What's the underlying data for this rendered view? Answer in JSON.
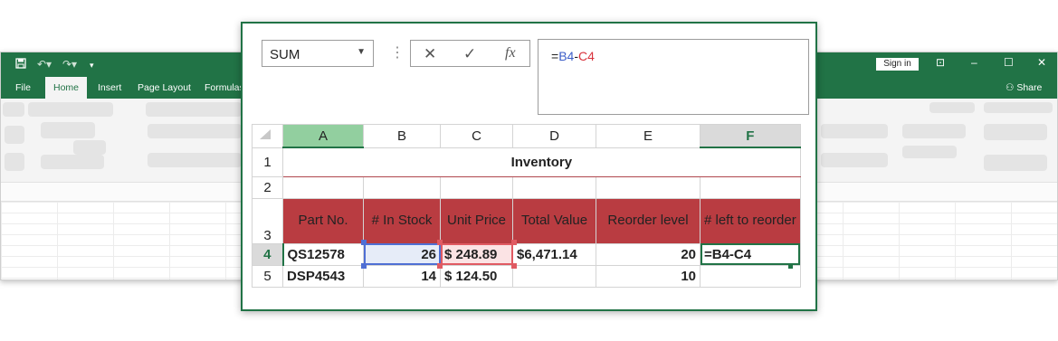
{
  "app": {
    "qat": {
      "save_icon": "save-icon",
      "undo_icon": "undo-icon",
      "redo_icon": "redo-icon",
      "customize_icon": "customize-icon"
    },
    "tabs": [
      "File",
      "Home",
      "Insert",
      "Page Layout",
      "Formulas"
    ],
    "active_tab": "Home",
    "sign_in": "Sign in",
    "share": "Share",
    "accent": "#217346"
  },
  "formula_bar": {
    "name_box": "SUM",
    "formula_parts": {
      "eq": "=",
      "ref1": "B4",
      "op": "-",
      "ref2": "C4"
    }
  },
  "sheet": {
    "columns": [
      "A",
      "B",
      "C",
      "D",
      "E",
      "F"
    ],
    "rows": [
      "1",
      "2",
      "3",
      "4",
      "5"
    ],
    "title": "Inventory",
    "headers": [
      "Part No.",
      "# In Stock",
      "Unit Price",
      "Total Value",
      "Reorder level",
      "# left to reorder"
    ],
    "data": [
      {
        "part": "QS12578",
        "stock": "26",
        "price": "$ 248.89",
        "total": "$6,471.14",
        "reorder": "20",
        "left": "=B4-C4"
      },
      {
        "part": "DSP4543",
        "stock": "14",
        "price": "$ 124.50",
        "total": "",
        "reorder": "10",
        "left": ""
      }
    ],
    "header_color": "#b93c41",
    "title_color": "#a3262c"
  }
}
